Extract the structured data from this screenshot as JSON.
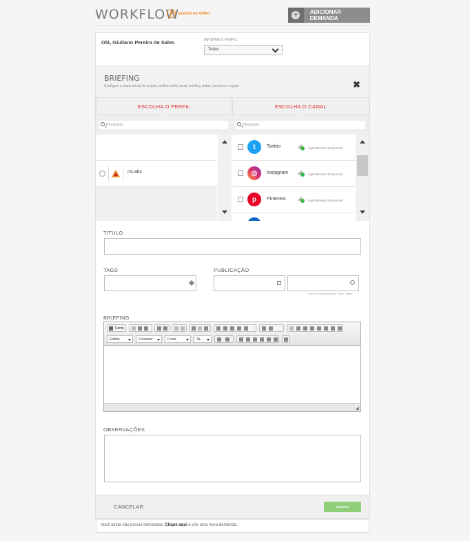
{
  "header": {
    "logo": "WORKFLOW",
    "video_link": "assista ao vídeo",
    "add_button": "ADICIONAR DEMANDA"
  },
  "greeting": "Olá, Giuliano Pereira de Sales",
  "perfil_filter": {
    "label": "INFORME O PERFIL:",
    "value": "Todos"
  },
  "briefing_header": {
    "title": "BRIEFING",
    "subtitle": "Configure a etapa inicial do projeto, define perfil, canal, briefing, datas, horários e equipe"
  },
  "profile_column": {
    "title": "ESCOLHA O PERFIL",
    "search_placeholder": "Pesquisar",
    "items": [
      {
        "name": "mLabs"
      }
    ]
  },
  "channel_column": {
    "title": "ESCOLHA O CANAL",
    "search_placeholder": "Pesquisar",
    "items": [
      {
        "name": "Twitter",
        "status": "Agendamento Disponível"
      },
      {
        "name": "Instagram",
        "status": "Agendamento Disponível"
      },
      {
        "name": "Pinterest",
        "status": "Agendamento Disponível"
      }
    ]
  },
  "form": {
    "titulo_label": "TÍTULO",
    "tags_label": "TAGS",
    "publicacao_label": "PUBLICAÇÃO",
    "timezone_note": "(GMT-03:00) America/Sao_Paulo · editar",
    "briefing_label": "BRIEFING",
    "observacoes_label": "OBSERVAÇÕES"
  },
  "editor": {
    "source_label": "Fonte",
    "dropdowns": [
      "Estilos",
      "Formatar",
      "Fonte",
      "Ta..."
    ]
  },
  "footer": {
    "cancel": "CANCELAR",
    "save": "SALVAR"
  },
  "empty_note": {
    "before": "Você ainda não possui demandas.",
    "link": "Clique aqui",
    "after": "e crie uma nova demanda."
  }
}
